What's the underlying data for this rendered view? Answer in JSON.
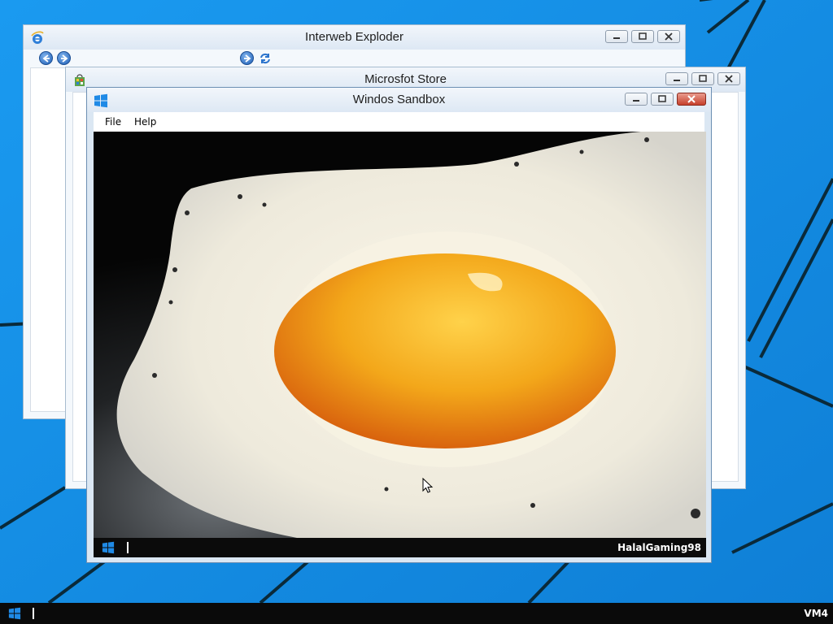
{
  "desktop": {
    "background_color": "#1c8ee0",
    "wallpaper": "windows-light-beams"
  },
  "windows": {
    "ie": {
      "title": "Interweb Exploder",
      "icon": "ie-logo-icon",
      "toolbar": [
        "back-icon",
        "forward-icon",
        "go-icon",
        "refresh-icon"
      ]
    },
    "store": {
      "title": "Microsfot Store",
      "icon": "store-icon"
    },
    "sandbox": {
      "title": "Windos Sandbox",
      "icon": "windows-logo-icon",
      "menu": {
        "file": "File",
        "help": "Help"
      },
      "vm": {
        "wallpaper": "fried-egg-photo",
        "taskbar": {
          "user_label": "HalalGaming98",
          "start_icon": "windows-logo-icon"
        }
      }
    }
  },
  "taskbar": {
    "label": "VM4",
    "start_icon": "windows-logo-icon"
  },
  "colors": {
    "accent": "#1c8ee0",
    "close_red": "#c6402b",
    "taskbar": "#0a0a0a"
  }
}
